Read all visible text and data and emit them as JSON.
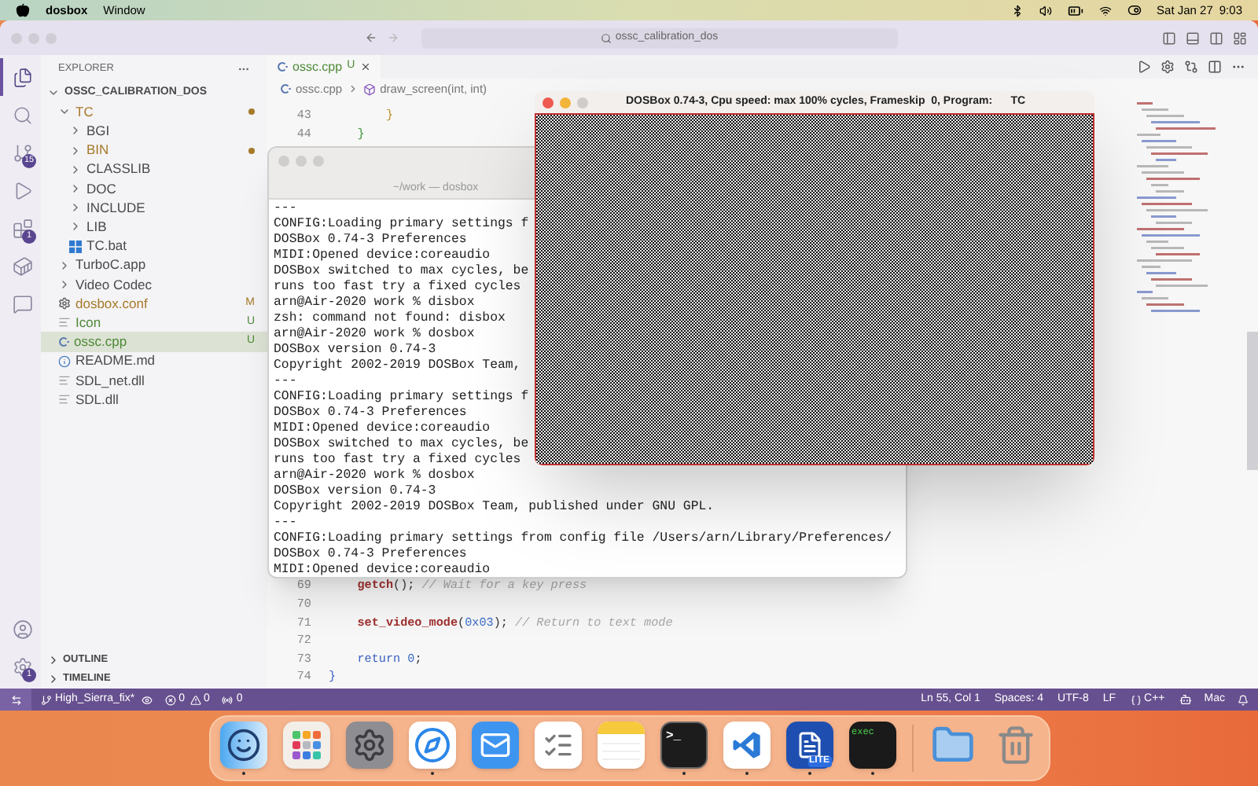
{
  "menu_bar": {
    "app": "dosbox",
    "menus": [
      "Window"
    ],
    "date": "Sat Jan 27",
    "time": "9:03"
  },
  "vscode": {
    "search": "ossc_calibration_dos",
    "activity_top": [
      {
        "kind": "files",
        "selected": true
      },
      {
        "kind": "search",
        "selected": false
      },
      {
        "kind": "source-control",
        "selected": false,
        "badge": "15"
      },
      {
        "kind": "run",
        "selected": false
      },
      {
        "kind": "extensions",
        "selected": false,
        "badge": "1"
      },
      {
        "kind": "docker",
        "selected": false
      },
      {
        "kind": "chat",
        "selected": false
      }
    ],
    "activity_bottom": [
      {
        "kind": "account",
        "selected": false
      },
      {
        "kind": "settings",
        "selected": false,
        "badge": "1"
      }
    ],
    "explorer_title": "EXPLORER",
    "tree": [
      {
        "name": "OSSC_CALIBRATION_DOS",
        "kind": "root",
        "expanded": true,
        "selected": false,
        "children": [
          {
            "name": "TC",
            "kind": "folder",
            "expanded": true,
            "selected": false,
            "color": "#a67a28",
            "children": [
              {
                "name": "BGI",
                "kind": "folder",
                "expanded": false,
                "selected": false
              },
              {
                "name": "BIN",
                "kind": "folder",
                "expanded": false,
                "selected": false,
                "color": "#a67a28"
              },
              {
                "name": "CLASSLIB",
                "kind": "folder",
                "expanded": false,
                "selected": false
              },
              {
                "name": "DOC",
                "kind": "folder",
                "expanded": false,
                "selected": false
              },
              {
                "name": "INCLUDE",
                "kind": "folder",
                "expanded": false,
                "selected": false
              },
              {
                "name": "LIB",
                "kind": "folder",
                "expanded": false,
                "selected": false
              },
              {
                "name": "TC.bat",
                "kind": "bat",
                "selected": false
              }
            ]
          },
          {
            "name": "TurboC.app",
            "kind": "folder",
            "expanded": false,
            "selected": false
          },
          {
            "name": "Video Codec",
            "kind": "folder",
            "expanded": false,
            "selected": false
          },
          {
            "name": "dosbox.conf",
            "kind": "config",
            "selected": false,
            "color": "#a67a28",
            "badge": "M"
          },
          {
            "name": "Icon",
            "kind": "text",
            "selected": false,
            "color": "#4d8a38",
            "badge": "U"
          },
          {
            "name": "ossc.cpp",
            "kind": "cpp",
            "selected": true,
            "color": "#4d8a38",
            "badge": "U"
          },
          {
            "name": "README.md",
            "kind": "info",
            "selected": false
          },
          {
            "name": "SDL_net.dll",
            "kind": "text",
            "selected": false
          },
          {
            "name": "SDL.dll",
            "kind": "text",
            "selected": false
          }
        ]
      }
    ],
    "panels": [
      {
        "title": "OUTLINE",
        "expanded": false
      },
      {
        "title": "TIMELINE",
        "expanded": false
      }
    ],
    "tab": {
      "label": "ossc.cpp",
      "badge": "U",
      "selected": true
    },
    "breadcrumb": [
      "ossc.cpp",
      "draw_screen(int, int)"
    ],
    "code_top": [
      {
        "number": "43",
        "tokens": [
          {
            "kind": "bracket",
            "color": "#b8902a",
            "text": "        }"
          }
        ]
      },
      {
        "number": "44",
        "tokens": [
          {
            "kind": "bracket",
            "color": "#3c963c",
            "text": "    }"
          }
        ]
      }
    ],
    "code_bottom": [
      {
        "number": "69",
        "tokens": [
          {
            "kind": "fn",
            "text": "    getch"
          },
          {
            "kind": "punct",
            "text": "();"
          },
          {
            "kind": "comment",
            "text": " // Wait for a key press"
          }
        ]
      },
      {
        "number": "70"
      },
      {
        "number": "71",
        "tokens": [
          {
            "kind": "fn",
            "text": "    set_video_mode"
          },
          {
            "kind": "punct",
            "text": "("
          },
          {
            "kind": "num",
            "text": "0x03"
          },
          {
            "kind": "punct",
            "text": ");"
          },
          {
            "kind": "comment",
            "text": " // Return to text mode"
          }
        ]
      },
      {
        "number": "72"
      },
      {
        "number": "73",
        "tokens": [
          {
            "kind": "keyword",
            "text": "    return"
          },
          {
            "kind": "num",
            "text": " 0"
          },
          {
            "kind": "punct",
            "text": ";"
          }
        ]
      },
      {
        "number": "74",
        "tokens": [
          {
            "kind": "bracket",
            "color": "#3b5fc0",
            "text": "}"
          }
        ]
      }
    ],
    "status_bar": {
      "branch": "High_Sierra_fix*",
      "errors": "0",
      "warnings": "0",
      "ports": "0",
      "items": [
        "Ln 55, Col 1",
        "Spaces: 4",
        "UTF-8",
        "LF"
      ],
      "language": "C++",
      "profile": "Mac"
    }
  },
  "terminal": {
    "title": "~/work — dosbox",
    "lines": [
      "---",
      "CONFIG:Loading primary settings f",
      "DOSBox 0.74-3 Preferences",
      "MIDI:Opened device:coreaudio",
      "DOSBox switched to max cycles, be",
      "runs too fast try a fixed cycles",
      "arn@Air-2020 work % disbox",
      "zsh: command not found: disbox",
      "arn@Air-2020 work % dosbox",
      "DOSBox version 0.74-3",
      "Copyright 2002-2019 DOSBox Team,",
      "---",
      "CONFIG:Loading primary settings f",
      "DOSBox 0.74-3 Preferences",
      "MIDI:Opened device:coreaudio",
      "DOSBox switched to max cycles, be",
      "runs too fast try a fixed cycles",
      "arn@Air-2020 work % dosbox",
      "DOSBox version 0.74-3",
      "Copyright 2002-2019 DOSBox Team, published under GNU GPL.",
      "---",
      "CONFIG:Loading primary settings from config file /Users/arn/Library/Preferences/",
      "DOSBox 0.74-3 Preferences",
      "MIDI:Opened device:coreaudio"
    ]
  },
  "dosbox": {
    "title": "DOSBox 0.74-3, Cpu speed: max 100% cycles, Frameskip  0, Program:      TC"
  },
  "dock": {
    "apps": [
      {
        "kind": "finder",
        "running": true
      },
      {
        "kind": "launchpad",
        "running": false
      },
      {
        "kind": "settings",
        "running": false
      },
      {
        "kind": "safari",
        "running": true
      },
      {
        "kind": "mail",
        "running": false
      },
      {
        "kind": "reminders",
        "running": false
      },
      {
        "kind": "notes",
        "running": false
      },
      {
        "kind": "terminal",
        "running": true,
        "label": ">_"
      },
      {
        "kind": "vscode",
        "running": true
      },
      {
        "kind": "lite",
        "running": true,
        "label": "LITE"
      },
      {
        "kind": "exec",
        "running": true,
        "label": "exec"
      }
    ],
    "stacks": [
      {
        "kind": "downloads",
        "running": false
      },
      {
        "kind": "trash",
        "running": false
      }
    ]
  }
}
